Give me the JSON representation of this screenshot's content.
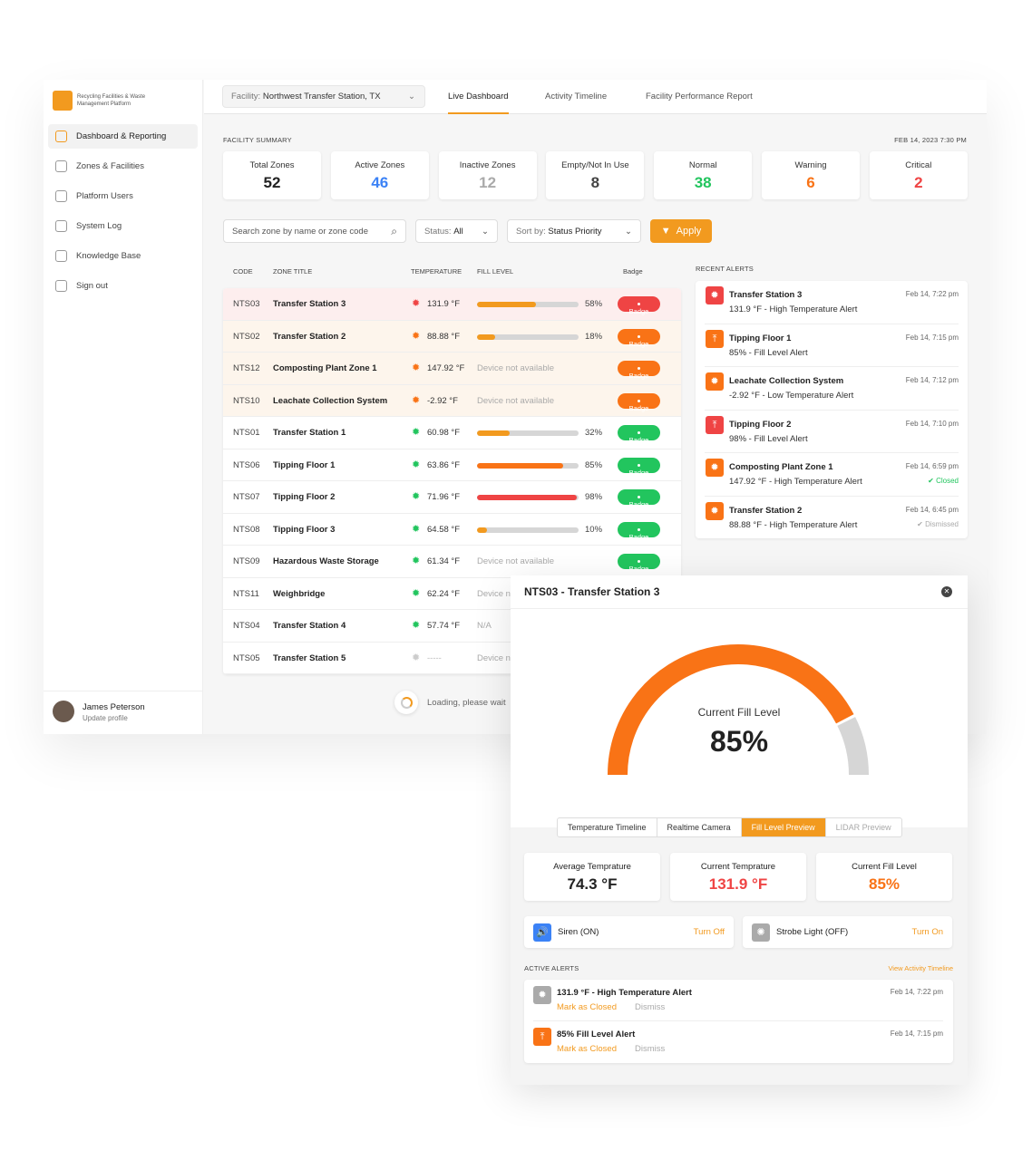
{
  "colors": {
    "accent": "#f29a1f",
    "critical": "#ef4444",
    "warning": "#f97316",
    "normal": "#22c55e",
    "blue": "#3b82f6"
  },
  "brand": {
    "name": "Recycling Facilities & Waste Management Platform"
  },
  "sidebar": {
    "items": [
      {
        "label": "Dashboard & Reporting",
        "icon": "chart-icon",
        "active": true
      },
      {
        "label": "Zones & Facilities",
        "icon": "location-pin-icon"
      },
      {
        "label": "Platform Users",
        "icon": "sliders-icon"
      },
      {
        "label": "System Log",
        "icon": "log-search-icon"
      },
      {
        "label": "Knowledge Base",
        "icon": "question-icon"
      },
      {
        "label": "Sign out",
        "icon": "sign-out-icon"
      }
    ],
    "user": {
      "name": "James Peterson",
      "sub": "Update profile"
    }
  },
  "header": {
    "facility_label": "Facility:",
    "facility_value": "Northwest Transfer Station, TX",
    "tabs": [
      {
        "label": "Live Dashboard",
        "active": true
      },
      {
        "label": "Activity Timeline"
      },
      {
        "label": "Facility Performance Report"
      }
    ]
  },
  "summary": {
    "label": "FACILITY SUMMARY",
    "datetime": "FEB 14, 2023 7:30 PM",
    "stats": [
      {
        "label": "Total Zones",
        "value": "52",
        "color": "#222222"
      },
      {
        "label": "Active Zones",
        "value": "46",
        "color": "#3b82f6"
      },
      {
        "label": "Inactive Zones",
        "value": "12",
        "color": "#aaaaaa"
      },
      {
        "label": "Empty/Not In Use",
        "value": "8",
        "color": "#444444"
      },
      {
        "label": "Normal",
        "value": "38",
        "color": "#22c55e"
      },
      {
        "label": "Warning",
        "value": "6",
        "color": "#f97316"
      },
      {
        "label": "Critical",
        "value": "2",
        "color": "#ef4444"
      }
    ]
  },
  "filters": {
    "search_placeholder": "Search zone by name or zone code",
    "status_label": "Status:",
    "status_value": "All",
    "sort_label": "Sort by:",
    "sort_value": "Status Priority",
    "apply": "Apply"
  },
  "table": {
    "headers": [
      "CODE",
      "ZONE TITLE",
      "TEMPERATURE",
      "FILL LEVEL",
      "Badge"
    ],
    "rows": [
      {
        "code": "NTS03",
        "title": "Transfer Station 3",
        "temp": "131.9 °F",
        "fill": 58,
        "fill_text": "58%",
        "status": "critical",
        "badge": "Badge"
      },
      {
        "code": "NTS02",
        "title": "Transfer Station 2",
        "temp": "88.88 °F",
        "fill": 18,
        "fill_text": "18%",
        "status": "warning",
        "badge": "Badge"
      },
      {
        "code": "NTS12",
        "title": "Composting Plant Zone 1",
        "temp": "147.92 °F",
        "fill_text": "Device not available",
        "status": "warning",
        "badge": "Badge"
      },
      {
        "code": "NTS10",
        "title": "Leachate Collection System",
        "temp": "-2.92 °F",
        "fill_text": "Device not available",
        "status": "warning",
        "badge": "Badge"
      },
      {
        "code": "NTS01",
        "title": "Transfer Station 1",
        "temp": "60.98 °F",
        "fill": 32,
        "fill_text": "32%",
        "status": "normal",
        "badge": "Badge"
      },
      {
        "code": "NTS06",
        "title": "Tipping Floor 1",
        "temp": "63.86 °F",
        "fill": 85,
        "fill_text": "85%",
        "status": "normal",
        "badge": "Badge"
      },
      {
        "code": "NTS07",
        "title": "Tipping Floor 2",
        "temp": "71.96 °F",
        "fill": 98,
        "fill_text": "98%",
        "status": "normal",
        "badge": "Badge"
      },
      {
        "code": "NTS08",
        "title": "Tipping Floor 3",
        "temp": "64.58 °F",
        "fill": 10,
        "fill_text": "10%",
        "status": "normal",
        "badge": "Badge"
      },
      {
        "code": "NTS09",
        "title": "Hazardous Waste Storage",
        "temp": "61.34 °F",
        "fill_text": "Device not available",
        "status": "normal",
        "badge": "Badge"
      },
      {
        "code": "NTS11",
        "title": "Weighbridge",
        "temp": "62.24 °F",
        "fill_text": "Device not available",
        "status": "normal"
      },
      {
        "code": "NTS04",
        "title": "Transfer Station 4",
        "temp": "57.74 °F",
        "fill_text": "N/A",
        "status": "normal"
      },
      {
        "code": "NTS05",
        "title": "Transfer Station 5",
        "temp": "-----",
        "fill_text": "Device not available",
        "status": "inactive"
      }
    ]
  },
  "loading": "Loading, please wait",
  "recent_alerts": {
    "label": "RECENT ALERTS",
    "items": [
      {
        "title": "Transfer Station 3",
        "desc": "131.9 °F - High Temperature Alert",
        "time": "Feb 14, 7:22 pm",
        "icon": "temperature-icon",
        "color": "#ef4444"
      },
      {
        "title": "Tipping Floor 1",
        "desc": "85% - Fill Level Alert",
        "time": "Feb 14, 7:15 pm",
        "icon": "fill-level-icon",
        "color": "#f97316"
      },
      {
        "title": "Leachate Collection System",
        "desc": "-2.92 °F - Low Temperature Alert",
        "time": "Feb 14, 7:12 pm",
        "icon": "temperature-icon",
        "color": "#f97316"
      },
      {
        "title": "Tipping Floor 2",
        "desc": "98% - Fill Level Alert",
        "time": "Feb 14, 7:10 pm",
        "icon": "fill-level-icon",
        "color": "#ef4444"
      },
      {
        "title": "Composting Plant Zone 1",
        "desc": "147.92 °F - High Temperature Alert",
        "time": "Feb 14, 6:59 pm",
        "icon": "temperature-icon",
        "color": "#f97316",
        "state": "Closed"
      },
      {
        "title": "Transfer Station 2",
        "desc": "88.88 °F - High Temperature Alert",
        "time": "Feb 14, 6:45 pm",
        "icon": "temperature-icon",
        "color": "#f97316",
        "state": "Dismissed"
      }
    ]
  },
  "panel": {
    "title": "NTS03 - Transfer Station 3",
    "gauge_label": "Current Fill Level",
    "gauge_value": 85,
    "gauge_text": "85%",
    "tabs": [
      {
        "label": "Temperature Timeline"
      },
      {
        "label": "Realtime Camera"
      },
      {
        "label": "Fill Level Preview",
        "active": true
      },
      {
        "label": "LIDAR Preview",
        "disabled": true
      }
    ],
    "stats": [
      {
        "label": "Average Temprature",
        "value": "74.3 °F",
        "color": "#222222"
      },
      {
        "label": "Current Temprature",
        "value": "131.9 °F",
        "color": "#ef4444"
      },
      {
        "label": "Current Fill Level",
        "value": "85%",
        "color": "#f97316"
      }
    ],
    "controls": [
      {
        "label": "Siren (ON)",
        "action": "Turn Off",
        "icon": "speaker-icon",
        "color": "#3b82f6"
      },
      {
        "label": "Strobe Light (OFF)",
        "action": "Turn On",
        "icon": "light-icon",
        "color": "#aaaaaa"
      }
    ],
    "active_alerts_label": "ACTIVE ALERTS",
    "view_timeline": "View Activity Timeline",
    "active_alerts": [
      {
        "title": "131.9 °F - High Temperature Alert",
        "time": "Feb 14, 7:22 pm",
        "icon": "temperature-icon",
        "color": "#aaaaaa",
        "close": "Mark as Closed",
        "dismiss": "Dismiss"
      },
      {
        "title": "85% Fill Level Alert",
        "time": "Feb 14, 7:15 pm",
        "icon": "fill-level-icon",
        "color": "#f97316",
        "close": "Mark as Closed",
        "dismiss": "Dismiss"
      }
    ]
  }
}
